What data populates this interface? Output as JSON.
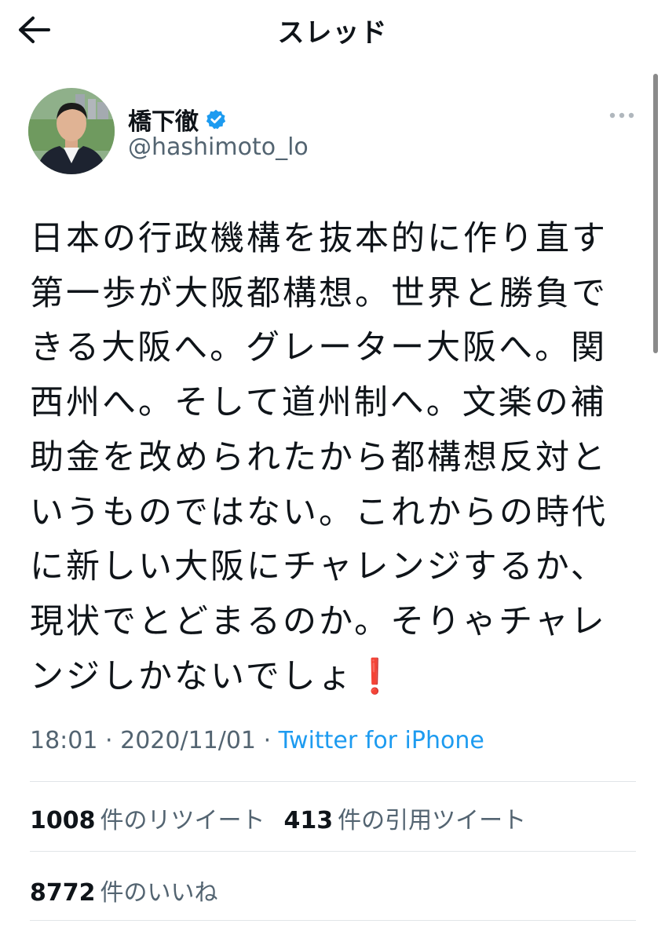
{
  "header": {
    "title": "スレッド",
    "back_icon": "arrow-left-icon"
  },
  "user": {
    "display_name": "橋下徹",
    "handle": "@hashimoto_lo",
    "verified": true,
    "verified_color": "#1d9bf0"
  },
  "tweet": {
    "text": "日本の行政機構を抜本的に作り直す第一歩が大阪都構想。世界と勝負できる大阪へ。グレーター大阪へ。関西州へ。そして道州制へ。文楽の補助金を改められたから都構想反対というものではない。これからの時代に新しい大阪にチャレンジするか、現状でとどまるのか。そりゃチャレンジしかないでしょ",
    "emoji": "❗",
    "time": "18:01",
    "separator": "·",
    "date": "2020/11/01",
    "source": "Twitter for iPhone"
  },
  "stats": {
    "retweets_count": "1008",
    "retweets_label": "件のリツイート",
    "quotes_count": "413",
    "quotes_label": "件の引用ツイート",
    "likes_count": "8772",
    "likes_label": "件のいいね"
  },
  "colors": {
    "accent": "#1d9bf0",
    "text": "#0f1419",
    "secondary": "#536471",
    "divider": "#e1e5e8"
  }
}
